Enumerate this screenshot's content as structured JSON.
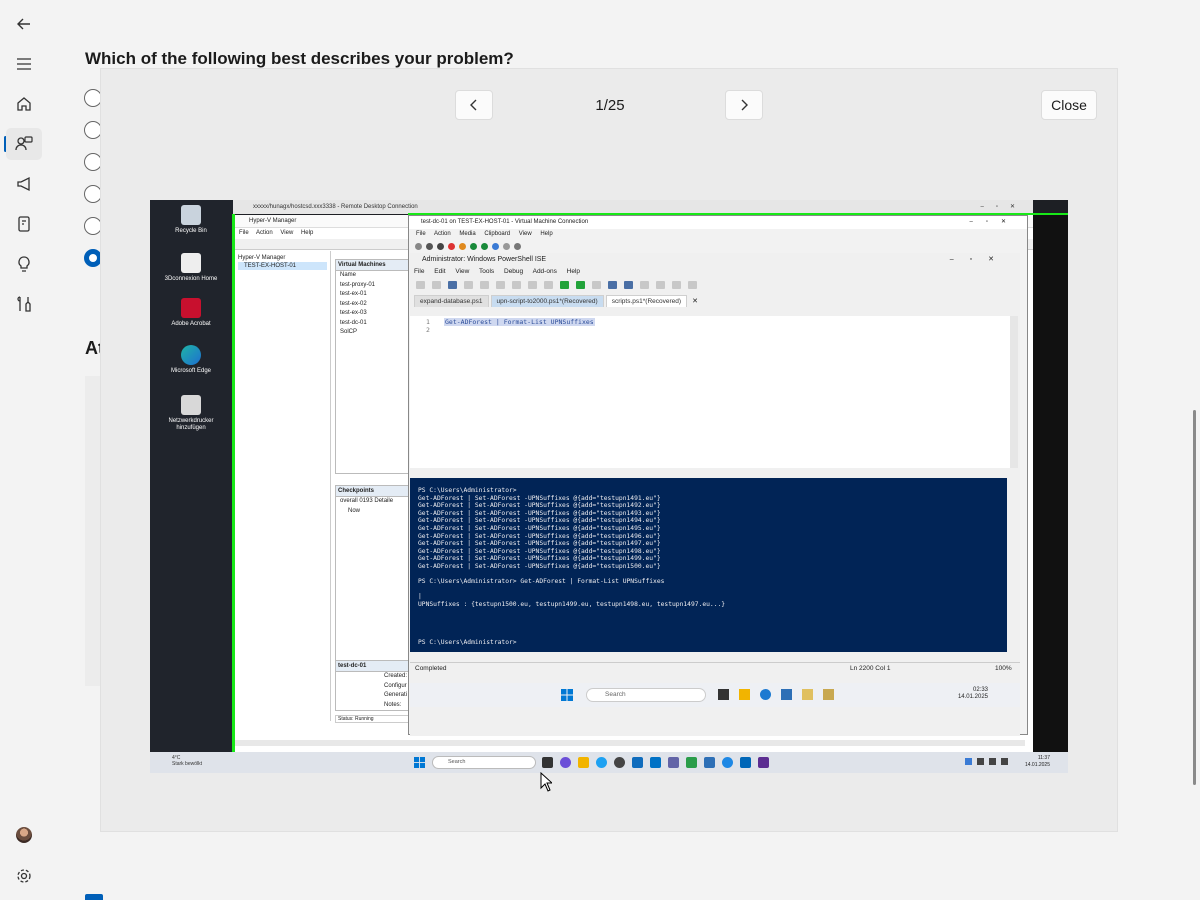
{
  "page": {
    "question": "Which of the following best describes your problem?",
    "section_heading_partial": "At"
  },
  "viewer": {
    "counter": "1/25",
    "close_label": "Close"
  },
  "screenshot": {
    "rdc_title": "xxxxx/hunagx/hostcsd.xxx3338 - Remote Desktop Connection",
    "desktop_icons": [
      "Recycle Bin",
      "3Dconnexion Home",
      "Adobe Acrobat",
      "Microsoft Edge",
      "Netzwerkdrucker hinzufügen"
    ],
    "hyperv": {
      "title": "Hyper-V Manager",
      "menu": [
        "File",
        "Action",
        "View",
        "Help"
      ],
      "tree": [
        "Hyper-V Manager",
        "TEST-EX-HOST-01"
      ],
      "vm_header": "Virtual Machines",
      "vm_col": "Name",
      "vms": [
        "test-proxy-01",
        "test-ex-01",
        "test-ex-02",
        "test-ex-03",
        "test-dc-01",
        "SolCP"
      ],
      "checkpoints_header": "Checkpoints",
      "checkpoints": [
        "overall 0193 Detaile",
        "Now"
      ],
      "details_header": "test-dc-01",
      "details_labels": [
        "Created:",
        "Configur",
        "Generati",
        "Notes:"
      ],
      "status": "Status: Running"
    },
    "vm_connection": {
      "title": "test-dc-01 on TEST-EX-HOST-01 - Virtual Machine Connection",
      "menu": [
        "File",
        "Action",
        "Media",
        "Clipboard",
        "View",
        "Help"
      ]
    },
    "ise": {
      "title": "Administrator: Windows PowerShell ISE",
      "menu": [
        "File",
        "Edit",
        "View",
        "Tools",
        "Debug",
        "Add-ons",
        "Help"
      ],
      "tabs": [
        "expand-database.ps1",
        "upn-script-to2000.ps1*(Recovered)",
        "scripts.ps1*(Recovered)"
      ],
      "editor_lines": [
        "1",
        "2"
      ],
      "editor_code": "Get-ADForest | Format-List UPNSuffixes",
      "console": "PS C:\\Users\\Administrator>\nGet-ADForest | Set-ADForest -UPNSuffixes @{add=\"testupn1491.eu\"}\nGet-ADForest | Set-ADForest -UPNSuffixes @{add=\"testupn1492.eu\"}\nGet-ADForest | Set-ADForest -UPNSuffixes @{add=\"testupn1493.eu\"}\nGet-ADForest | Set-ADForest -UPNSuffixes @{add=\"testupn1494.eu\"}\nGet-ADForest | Set-ADForest -UPNSuffixes @{add=\"testupn1495.eu\"}\nGet-ADForest | Set-ADForest -UPNSuffixes @{add=\"testupn1496.eu\"}\nGet-ADForest | Set-ADForest -UPNSuffixes @{add=\"testupn1497.eu\"}\nGet-ADForest | Set-ADForest -UPNSuffixes @{add=\"testupn1498.eu\"}\nGet-ADForest | Set-ADForest -UPNSuffixes @{add=\"testupn1499.eu\"}\nGet-ADForest | Set-ADForest -UPNSuffixes @{add=\"testupn1500.eu\"}\n\nPS C:\\Users\\Administrator> Get-ADForest | Format-List UPNSuffixes\n\n|\nUPNSuffixes : {testupn1500.eu, testupn1499.eu, testupn1498.eu, testupn1497.eu...}\n\n\n\n\nPS C:\\Users\\Administrator>",
      "status": "Completed",
      "position": "Ln 2200  Col 1",
      "zoom": "100%"
    },
    "vm_taskbar": {
      "search": "Search",
      "time": "02:33",
      "date": "14.01.2025"
    },
    "host_taskbar": {
      "weather_temp": "4°C",
      "weather_desc": "Stark bewölkt",
      "search": "Search",
      "time": "11:37",
      "date": "14.01.2025"
    }
  },
  "colors": {
    "accent": "#005fb8",
    "console_bg": "#012456",
    "highlight_green": "#18e818"
  }
}
